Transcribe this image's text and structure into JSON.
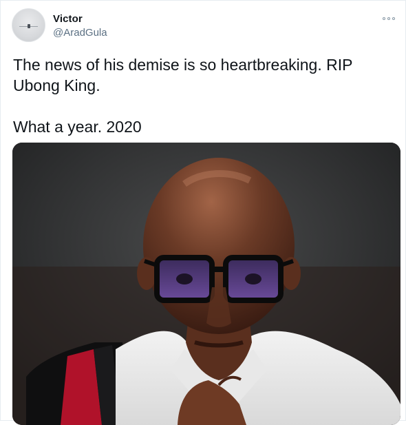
{
  "tweet": {
    "author_name": "Victor",
    "author_handle": "@AradGula",
    "text": "The news of his demise is so heartbreaking. RIP Ubong King.\n\nWhat a year. 2020",
    "more_icon": "more-horizontal-icon",
    "avatar_icon": "avatar-image",
    "media_description_icon": "portrait-photo"
  },
  "colors": {
    "text_primary": "#0f1419",
    "text_secondary": "#5b7083",
    "border": "#e6ecf0"
  }
}
